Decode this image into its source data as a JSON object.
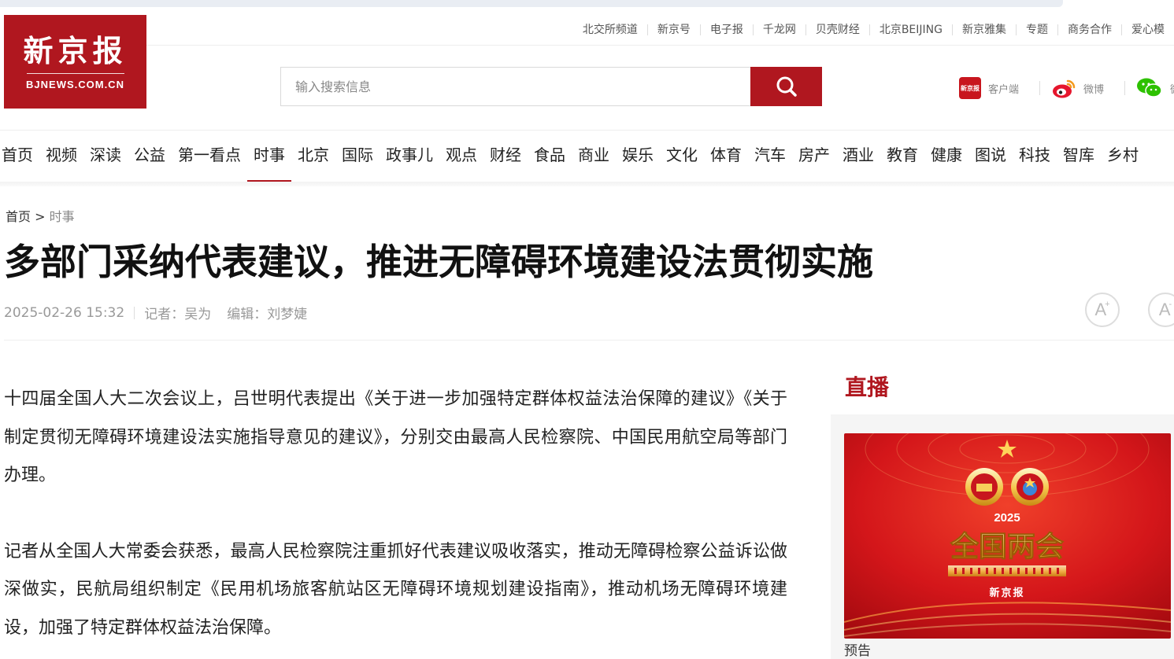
{
  "logo": {
    "cn": "新京报",
    "en": "BJNEWS.COM.CN"
  },
  "topnav": [
    "北交所频道",
    "新京号",
    "电子报",
    "千龙网",
    "贝壳财经",
    "北京BEIJING",
    "新京雅集",
    "专题",
    "商务合作",
    "爱心模"
  ],
  "search": {
    "placeholder": "输入搜索信息"
  },
  "social": {
    "app_badge": "新京报",
    "app": "客户端",
    "weibo": "微博",
    "wechat": "微"
  },
  "mainnav": [
    "首页",
    "视频",
    "深读",
    "公益",
    "第一看点",
    "时事",
    "北京",
    "国际",
    "政事儿",
    "观点",
    "财经",
    "食品",
    "商业",
    "娱乐",
    "文化",
    "体育",
    "汽车",
    "房产",
    "酒业",
    "教育",
    "健康",
    "图说",
    "科技",
    "智库",
    "乡村"
  ],
  "mainnav_active": "时事",
  "breadcrumb": {
    "home": "首页",
    "sep": " > ",
    "current": "时事"
  },
  "article": {
    "title": "多部门采纳代表建议，推进无障碍环境建设法贯彻实施",
    "date": "2025-02-26 15:32",
    "reporter": "记者：吴为",
    "editor": "编辑：刘梦婕",
    "paragraphs": [
      "十四届全国人大二次会议上，吕世明代表提出《关于进一步加强特定群体权益法治保障的建议》《关于制定贯彻无障碍环境建设法实施指导意见的建议》，分别交由最高人民检察院、中国民用航空局等部门办理。",
      "记者从全国人大常委会获悉，最高人民检察院注重抓好代表建议吸收落实，推动无障碍检察公益诉讼做深做实，民航局组织制定《民用机场旅客航站区无障碍环境规划建设指南》，推动机场无障碍环境建设，加强了特定群体权益法治保障。"
    ]
  },
  "font_controls": [
    "A",
    "A"
  ],
  "sidebar": {
    "title": "直播",
    "card": {
      "year": "2025",
      "headline": "全国两会",
      "brand": "新京报",
      "caption": "预告"
    }
  },
  "colors": {
    "brand": "#b0171f"
  }
}
